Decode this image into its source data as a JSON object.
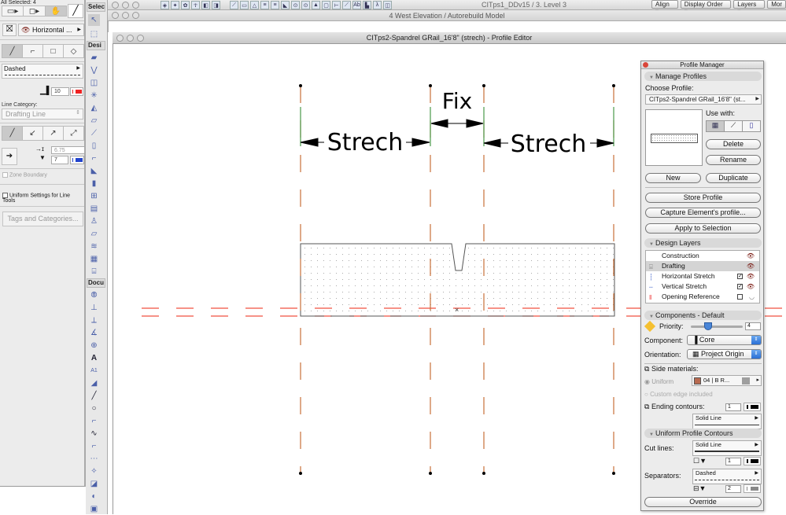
{
  "info_box": {
    "selection_header": "All Selected: 4",
    "layer_value": "Horizontal ...",
    "line_type": "Dashed",
    "pen_number": "10",
    "line_category_label": "Line Category:",
    "line_category_value": "Drafting Line",
    "arrow_size": "6.75",
    "arrow_pen": "7",
    "zone_boundary_label": "Zone Boundary",
    "uniform_settings_label": "Uniform Settings for Line Tools",
    "tags_button": "Tags and Categories..."
  },
  "toolbox": {
    "headers": [
      "Selec",
      "Desi",
      "Docu"
    ]
  },
  "windows": {
    "plan_title": "CITps1_DDv15 / 3. Level 3",
    "elevation_title": "4 West Elevation / Autorebuild Model",
    "profile_editor_title": "CITps2-Spandrel GRail_16'8\" (strech) - Profile Editor"
  },
  "top_right_menus": [
    "Align",
    "Display Order",
    "Layers",
    "Mor"
  ],
  "canvas": {
    "labels": {
      "left": "Strech",
      "middle": "Fix",
      "right": "Strech"
    },
    "colors": {
      "stretch_line": "#c8703a",
      "stretch_inner": "#4a9a4a",
      "ref_line": "#f05040",
      "profile_border": "#555555"
    }
  },
  "profile_manager": {
    "title": "Profile Manager",
    "manage_section": "Manage Profiles",
    "choose_label": "Choose Profile:",
    "profile_value": "CITps2-Spandrel GRail_16'8\" (st...",
    "use_with_label": "Use with:",
    "delete": "Delete",
    "rename": "Rename",
    "new": "New",
    "duplicate": "Duplicate",
    "store": "Store Profile",
    "capture": "Capture Element's profile...",
    "apply": "Apply to Selection",
    "design_layers_section": "Design Layers",
    "layers": [
      {
        "name": "Construction",
        "checkbox": null,
        "visible": true
      },
      {
        "name": "Drafting",
        "checkbox": null,
        "visible": true,
        "selected": true
      },
      {
        "name": "Horizontal Stretch",
        "checkbox": true,
        "visible": true
      },
      {
        "name": "Vertical Stretch",
        "checkbox": true,
        "visible": true
      },
      {
        "name": "Opening Reference",
        "checkbox": false,
        "visible": false
      }
    ],
    "components_section": "Components - Default",
    "priority_label": "Priority:",
    "priority_value": "4",
    "priority_slider_fraction": 0.3,
    "component_label": "Component:",
    "component_value": "Core",
    "orientation_label": "Orientation:",
    "orientation_value": "Project Origin",
    "side_materials_label": "Side materials:",
    "uniform_label": "Uniform",
    "material_value": "04 | B R...",
    "custom_edge_label": "Custom edge included",
    "ending_contours_label": "Ending contours:",
    "ending_pen": "1",
    "ending_line": "Solid Line",
    "uniform_contours_section": "Uniform Profile Contours",
    "cut_lines_label": "Cut lines:",
    "cut_line_type": "Solid Line",
    "cut_pen": "1",
    "separators_label": "Separators:",
    "separator_type": "Dashed",
    "separator_pen": "2",
    "override": "Override"
  }
}
